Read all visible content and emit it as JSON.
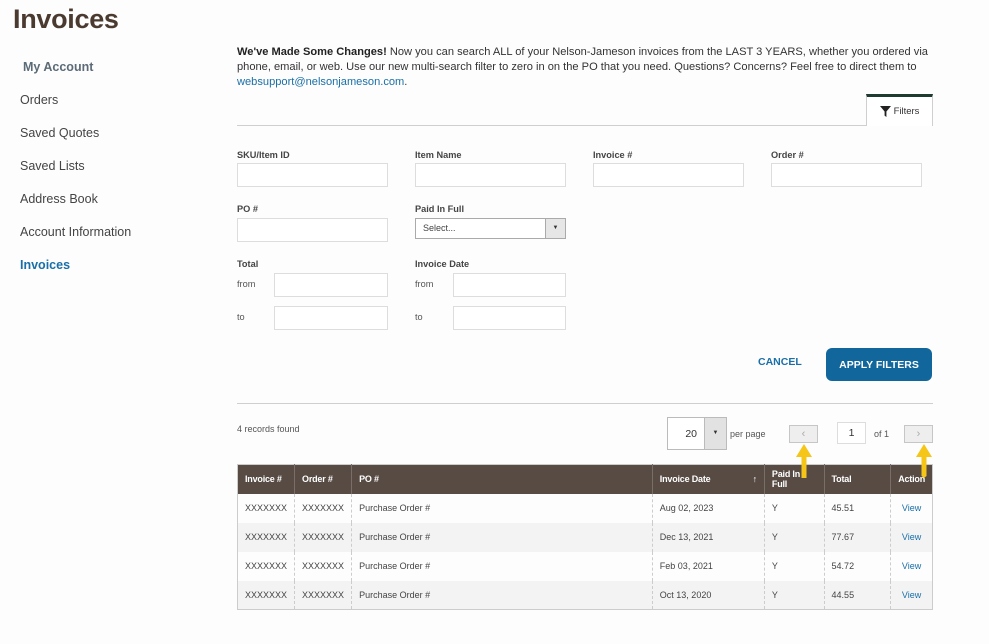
{
  "page": {
    "title": "Invoices"
  },
  "sidebar": {
    "heading": "My Account",
    "items": [
      {
        "label": "Orders",
        "active": false
      },
      {
        "label": "Saved Quotes",
        "active": false
      },
      {
        "label": "Saved Lists",
        "active": false
      },
      {
        "label": "Address Book",
        "active": false
      },
      {
        "label": "Account Information",
        "active": false
      },
      {
        "label": "Invoices",
        "active": true
      }
    ]
  },
  "notice": {
    "bold": "We've Made Some Changes!",
    "text": " Now you can search ALL of your Nelson-Jameson invoices from the LAST 3 YEARS, whether you ordered via phone, email, or web. Use our new multi-search filter to zero in on the PO that you need. Questions? Concerns? Feel free to direct them to ",
    "link": "websupport@nelsonjameson.com",
    "end": "."
  },
  "filters_tab": {
    "label": "Filters",
    "icon": "funnel-icon"
  },
  "form": {
    "sku_label": "SKU/Item ID",
    "item_name_label": "Item Name",
    "invoice_label": "Invoice #",
    "order_label": "Order #",
    "po_label": "PO #",
    "paid_label": "Paid In Full",
    "paid_value": "Select...",
    "total_label": "Total",
    "invoice_date_label": "Invoice Date",
    "from_label": "from",
    "to_label": "to",
    "sku_value": "",
    "item_name_value": "",
    "invoice_value": "",
    "order_value": "",
    "po_value": "",
    "total_from": "",
    "total_to": "",
    "date_from": "",
    "date_to": ""
  },
  "actions": {
    "cancel": "CANCEL",
    "apply": "APPLY FILTERS"
  },
  "results": {
    "records_found": "4 records found",
    "per_page": "20",
    "per_page_label": "per page",
    "page": "1",
    "of_label": "of 1",
    "prev": "‹",
    "next": "›"
  },
  "table": {
    "headers": [
      "Invoice #",
      "Order #",
      "PO #",
      "Invoice Date",
      "Paid In Full",
      "Total",
      "Action"
    ],
    "sort_icon": "↑",
    "rows": [
      [
        "XXXXXXX",
        "XXXXXXX",
        "Purchase Order #",
        "Aug 02, 2023",
        "Y",
        "45.51",
        "View"
      ],
      [
        "XXXXXXX",
        "XXXXXXX",
        "Purchase Order #",
        "Dec 13, 2021",
        "Y",
        "77.67",
        "View"
      ],
      [
        "XXXXXXX",
        "XXXXXXX",
        "Purchase Order #",
        "Feb 03, 2021",
        "Y",
        "54.72",
        "View"
      ],
      [
        "XXXXXXX",
        "XXXXXXX",
        "Purchase Order #",
        "Oct 13, 2020",
        "Y",
        "44.55",
        "View"
      ]
    ]
  },
  "colors": {
    "accent": "#11679c",
    "link": "#1a6fa8",
    "table_header": "#574b44",
    "annotation": "#f5c518"
  }
}
